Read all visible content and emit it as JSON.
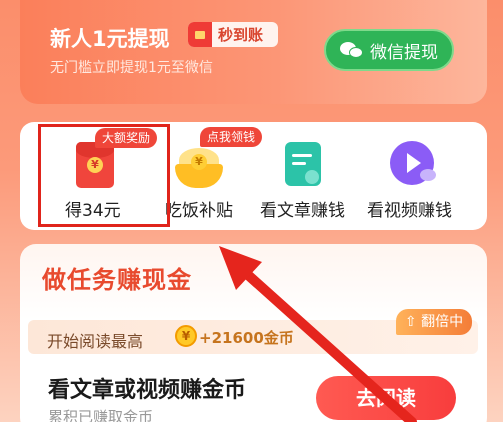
{
  "withdraw_card": {
    "title": "新人1元提现",
    "badge": "秒到账",
    "subtitle": "无门槛立即提现1元至微信",
    "button_label": "微信提现"
  },
  "quick_actions": [
    {
      "label": "得34元",
      "tag": "大额奖励",
      "icon": "red-envelope-icon"
    },
    {
      "label": "吃饭补贴",
      "tag": "点我领钱",
      "icon": "rice-bowl-icon"
    },
    {
      "label": "看文章赚钱",
      "icon": "article-icon"
    },
    {
      "label": "看视频赚钱",
      "icon": "video-play-icon"
    }
  ],
  "tasks": {
    "section_title": "做任务赚现金",
    "read_banner": {
      "label": "开始阅读最高",
      "coin_amount": "+21600金币",
      "badge": "翻倍中"
    },
    "item": {
      "title": "看文章或视频赚金币",
      "subtitle": "累积已赚取金币",
      "button_label": "去阅读"
    }
  },
  "colors": {
    "accent": "#fb8e6b",
    "wechat_green": "#2fb457",
    "highlight_red": "#e0241b"
  }
}
